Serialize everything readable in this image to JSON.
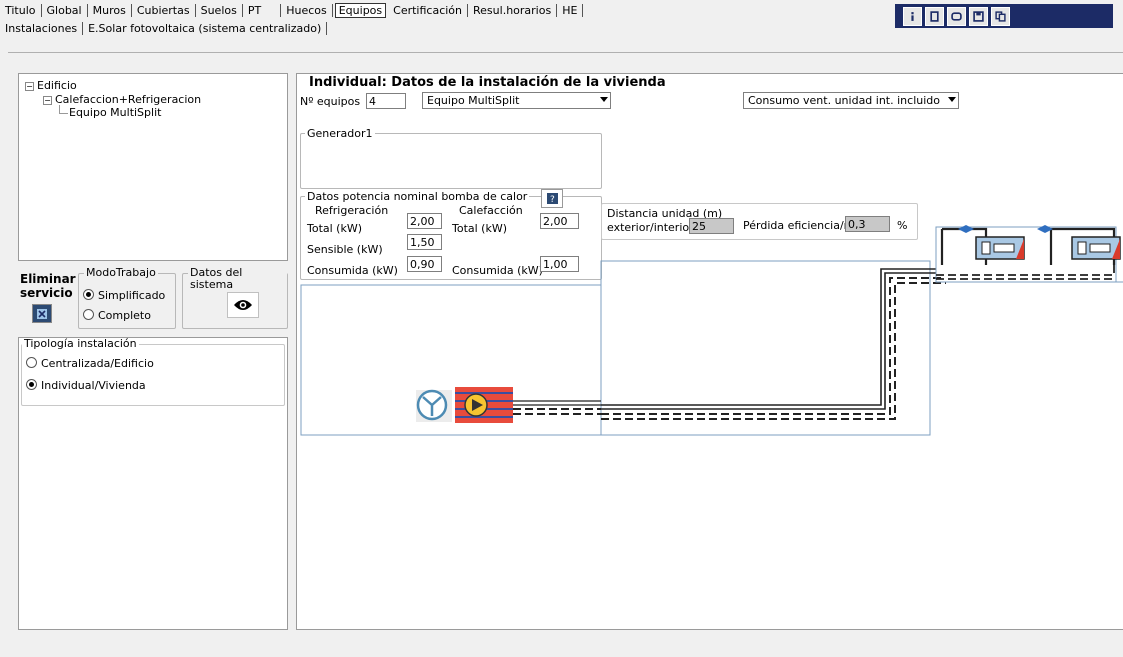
{
  "tabs_row1": [
    "Titulo",
    "Global",
    "Muros",
    "Cubiertas",
    "Suelos",
    "PT",
    "Huecos",
    "Equipos",
    "Certificación",
    "Resul.horarios",
    "HE"
  ],
  "tabs_row1_active": "Equipos",
  "tabs_row2": [
    "Instalaciones",
    "E.Solar fotovoltaica (sistema centralizado)"
  ],
  "toolbar_icons": [
    "info-icon",
    "document-icon",
    "window-icon",
    "save-icon",
    "copy-icon"
  ],
  "tree": {
    "root": "Edificio",
    "child": "Calefaccion+Refrigeracion",
    "leaf": "Equipo MultiSplit",
    "expander": "−"
  },
  "left": {
    "eliminar_label": "Eliminar servicio",
    "modo_trabajo_legend": "ModoTrabajo",
    "modo_simplificado": "Simplificado",
    "modo_completo": "Completo",
    "datos_sistema_legend": "Datos del sistema",
    "tipologia_legend": "Tipología instalación",
    "tipologia_centralizada": "Centralizada/Edificio",
    "tipologia_individual": "Individual/Vivienda"
  },
  "main": {
    "title": "Individual: Datos de la instalación de la vivienda",
    "n_equipos_label": "Nº equipos",
    "n_equipos_value": "4",
    "equipo_select": "Equipo MultiSplit",
    "consumo_select": "Consumo vent. unidad int. incluido",
    "generador_legend": "Generador1",
    "potencia_legend": "Datos potencia nominal bomba de calor",
    "refrigeracion_header": "Refrigeración",
    "calefaccion_header": "Calefacción",
    "total_label": "Total (kW)",
    "total_refrig": "2,00",
    "total_calef": "2,00",
    "sensible_label": "Sensible (kW)",
    "sensible_value": "1,50",
    "consumida_label": "Consumida (kW)",
    "consumida_refrig": "0,90",
    "consumida_calef": "1,00",
    "distancia_label_1": "Distancia unidad (m)",
    "distancia_label_2": "exterior/interior",
    "distancia_value": "25",
    "perdida_label": "Pérdida eficiencia/m",
    "perdida_value": "0,3",
    "perdida_unit": "%"
  }
}
